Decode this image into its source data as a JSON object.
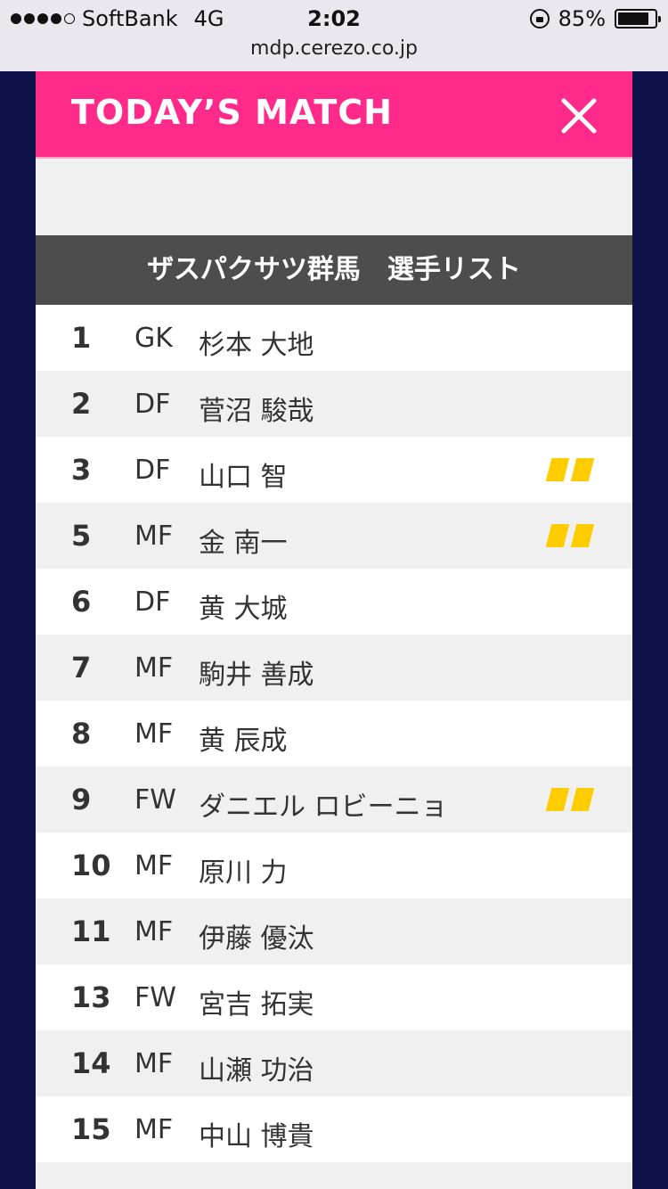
{
  "status_bar": {
    "carrier": "SoftBank",
    "network": "4G",
    "time": "2:02",
    "battery_percent": "85%",
    "battery_level": 0.85
  },
  "browser": {
    "url": "mdp.cerezo.co.jp"
  },
  "panel": {
    "title": "TODAY’S MATCH",
    "close_icon": "close-icon",
    "list_title": "ザスパクサツ群馬　選手リスト",
    "accent_color": "#ff2a8a",
    "card_color": "#ffcc00"
  },
  "players": [
    {
      "number": "1",
      "position": "GK",
      "name": "杉本 大地",
      "cards": false
    },
    {
      "number": "2",
      "position": "DF",
      "name": "菅沼 駿哉",
      "cards": false
    },
    {
      "number": "3",
      "position": "DF",
      "name": "山口 智",
      "cards": true
    },
    {
      "number": "5",
      "position": "MF",
      "name": "金 南一",
      "cards": true
    },
    {
      "number": "6",
      "position": "DF",
      "name": "黄 大城",
      "cards": false
    },
    {
      "number": "7",
      "position": "MF",
      "name": "駒井 善成",
      "cards": false
    },
    {
      "number": "8",
      "position": "MF",
      "name": "黄 辰成",
      "cards": false
    },
    {
      "number": "9",
      "position": "FW",
      "name": "ダニエル ロビーニョ",
      "cards": true
    },
    {
      "number": "10",
      "position": "MF",
      "name": "原川 力",
      "cards": false
    },
    {
      "number": "11",
      "position": "MF",
      "name": "伊藤 優汰",
      "cards": false
    },
    {
      "number": "13",
      "position": "FW",
      "name": "宮吉 拓実",
      "cards": false
    },
    {
      "number": "14",
      "position": "MF",
      "name": "山瀬 功治",
      "cards": false
    },
    {
      "number": "15",
      "position": "MF",
      "name": "中山 博貴",
      "cards": false
    }
  ]
}
